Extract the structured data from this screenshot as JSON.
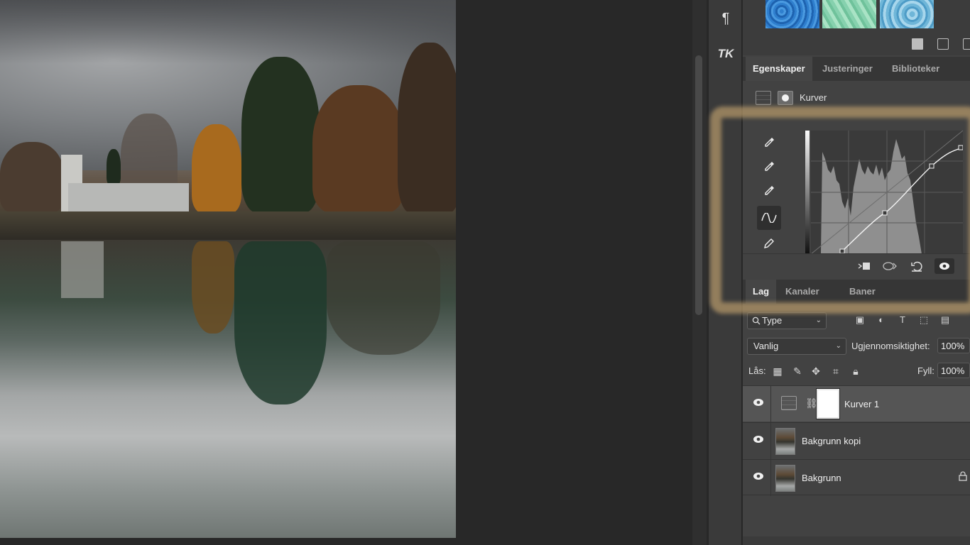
{
  "icon_strip": {
    "paragraph_icon": "pilcrow-icon",
    "paragraph_glyph": "¶",
    "tk_icon": "tk-plugin-icon",
    "tk_glyph": "TK"
  },
  "swatches": {
    "colors": [
      "#2f7fce",
      "#86d1ae",
      "#6fb6d8"
    ]
  },
  "properties_tabs": [
    {
      "label": "Egenskaper",
      "active": true
    },
    {
      "label": "Justeringer",
      "active": false
    },
    {
      "label": "Biblioteker",
      "active": false
    }
  ],
  "properties": {
    "title": "Kurver"
  },
  "layers_tabs": [
    {
      "label": "Lag",
      "active": true
    },
    {
      "label": "Kanaler",
      "active": false
    },
    {
      "label": "Baner",
      "active": false
    }
  ],
  "layers_panel": {
    "filter_value": "Type",
    "blend_mode": "Vanlig",
    "opacity_label": "Ugjennomsiktighet:",
    "opacity_value": "100%",
    "lock_label": "Lås:",
    "fill_label": "Fyll:",
    "fill_value": "100%"
  },
  "layers": [
    {
      "name": "Kurver 1",
      "type": "adjustment",
      "selected": true,
      "locked": false
    },
    {
      "name": "Bakgrunn kopi",
      "type": "image",
      "selected": false,
      "locked": false
    },
    {
      "name": "Bakgrunn",
      "type": "image",
      "selected": false,
      "locked": true
    }
  ],
  "highlight_color": "#b29668"
}
